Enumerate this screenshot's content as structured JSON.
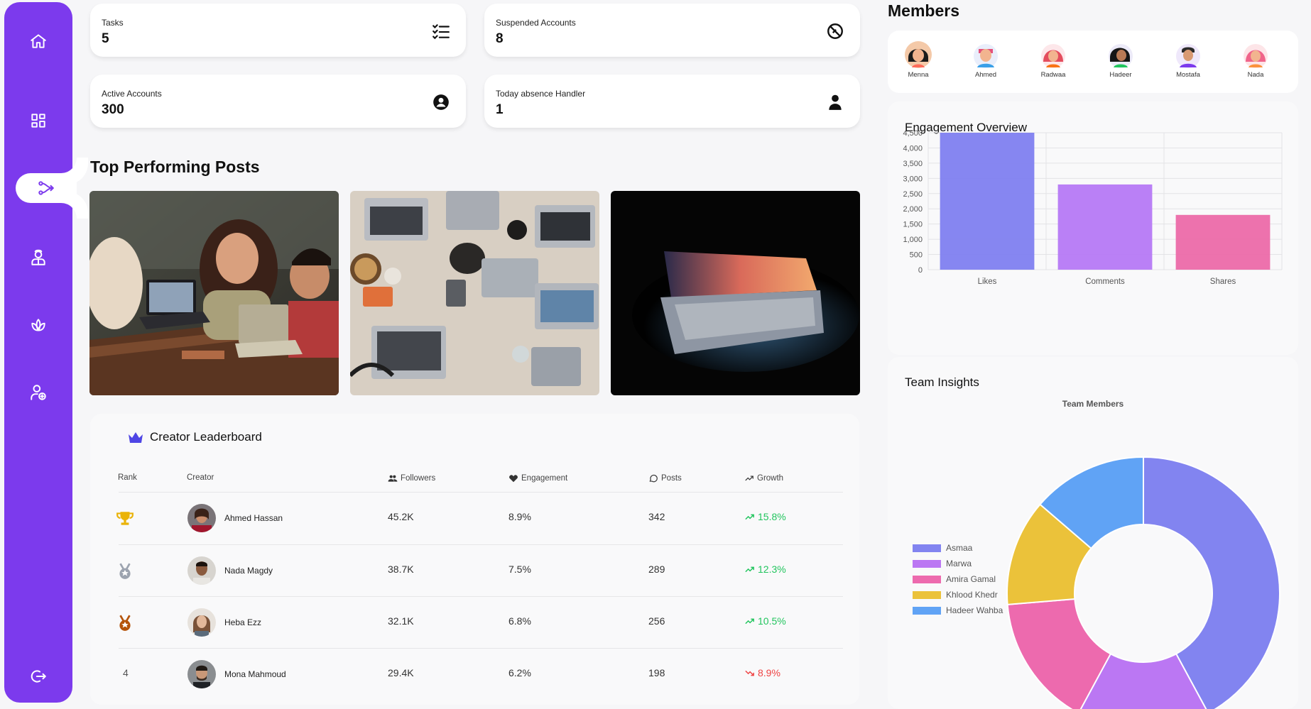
{
  "sidebar": {
    "items": [
      {
        "icon": "home-icon"
      },
      {
        "icon": "dashboard-icon"
      },
      {
        "icon": "share-icon"
      },
      {
        "icon": "user-badge-icon"
      },
      {
        "icon": "lotus-icon"
      },
      {
        "icon": "add-user-icon"
      }
    ],
    "logout_icon": "logout-icon",
    "accent": "#7c3aed"
  },
  "stats": [
    {
      "label": "Tasks",
      "value": "5",
      "icon": "checklist-icon"
    },
    {
      "label": "Suspended Accounts",
      "value": "8",
      "icon": "ban-icon"
    },
    {
      "label": "Active Accounts",
      "value": "300",
      "icon": "user-circle-icon"
    },
    {
      "label": "Today absence Handler",
      "value": "1",
      "icon": "user-icon"
    }
  ],
  "posts": {
    "title": "Top Performing Posts"
  },
  "leaderboard": {
    "title": "Creator Leaderboard",
    "headers": {
      "rank": "Rank",
      "creator": "Creator",
      "followers": "Followers",
      "engagement": "Engagement",
      "posts": "Posts",
      "growth": "Growth"
    },
    "rows": [
      {
        "rank": "",
        "rank_icon": "gold-trophy-icon",
        "name": "Ahmed Hassan",
        "followers": "45.2K",
        "engagement": "8.9%",
        "posts": "342",
        "growth": "15.8%",
        "trend": "up"
      },
      {
        "rank": "",
        "rank_icon": "silver-medal-icon",
        "name": "Nada Magdy",
        "followers": "38.7K",
        "engagement": "7.5%",
        "posts": "289",
        "growth": "12.3%",
        "trend": "up"
      },
      {
        "rank": "",
        "rank_icon": "bronze-medal-icon",
        "name": "Heba Ezz",
        "followers": "32.1K",
        "engagement": "6.8%",
        "posts": "256",
        "growth": "10.5%",
        "trend": "up"
      },
      {
        "rank": "4",
        "rank_icon": "",
        "name": "Mona Mahmoud",
        "followers": "29.4K",
        "engagement": "6.2%",
        "posts": "198",
        "growth": "8.9%",
        "trend": "down"
      }
    ]
  },
  "members": {
    "title": "Members",
    "list": [
      "Menna",
      "Ahmed",
      "Radwaa",
      "Hadeer",
      "Mostafa",
      "Nada"
    ]
  },
  "engagement": {
    "title": "Engagement Overview"
  },
  "team": {
    "title": "Team Insights",
    "chart_title": "Team Members"
  },
  "chart_data": [
    {
      "type": "bar",
      "title": "Engagement Overview",
      "categories": [
        "Likes",
        "Comments",
        "Shares"
      ],
      "values": [
        4500,
        2800,
        1800
      ],
      "colors": [
        "#7f7ff0",
        "#b679f5",
        "#ec6aa9"
      ],
      "ylim": [
        0,
        4500
      ],
      "yticks": [
        "0",
        "500",
        "1,000",
        "1,500",
        "2,000",
        "2,500",
        "3,000",
        "3,500",
        "4,000",
        "4,500"
      ],
      "grid": true
    },
    {
      "type": "pie",
      "title": "Team Members",
      "labels": [
        "Asmaa",
        "Marwa",
        "Amira Gamal",
        "Khlood Khedr",
        "Hadeer Wahba"
      ],
      "values": [
        40,
        15,
        15,
        12,
        13
      ],
      "colors": [
        "#8284f0",
        "#bb77f3",
        "#ed6aae",
        "#ebc23a",
        "#60a3f5"
      ],
      "legend": "left"
    }
  ]
}
